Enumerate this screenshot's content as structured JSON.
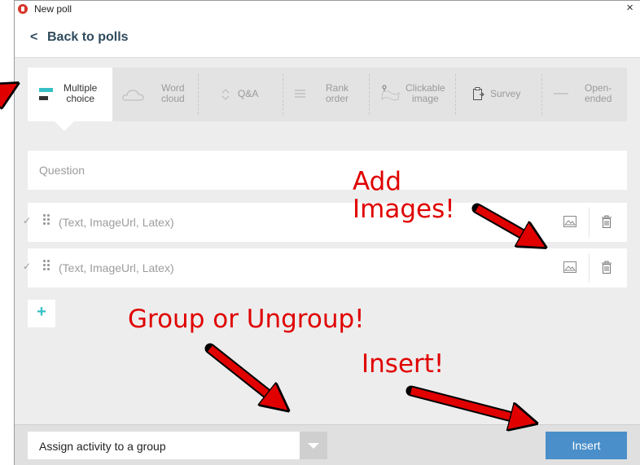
{
  "window": {
    "title": "New poll",
    "close_symbol": "×"
  },
  "nav": {
    "back_label": "Back to polls",
    "back_icon": "chevron-left-icon"
  },
  "poll_types": [
    {
      "label": "Multiple\nchoice",
      "icon": "multiple-choice-icon",
      "active": true
    },
    {
      "label": "Word\ncloud",
      "icon": "cloud-icon"
    },
    {
      "label": "Q&A",
      "icon": "up-down-icon"
    },
    {
      "label": "Rank\norder",
      "icon": "rank-list-icon"
    },
    {
      "label": "Clickable\nimage",
      "icon": "map-pin-icon"
    },
    {
      "label": "Survey",
      "icon": "clipboard-icon"
    },
    {
      "label": "Open-\nended",
      "icon": "dash-icon"
    }
  ],
  "question": {
    "placeholder": "Question"
  },
  "options": [
    {
      "placeholder": "(Text, ImageUrl, Latex)"
    },
    {
      "placeholder": "(Text, ImageUrl, Latex)"
    }
  ],
  "add_option": {
    "symbol": "+"
  },
  "footer": {
    "assign_label": "Assign activity to a group",
    "insert_label": "Insert"
  },
  "annotations": {
    "add_images": "Add\nImages!",
    "group": "Group or Ungroup!",
    "insert": "Insert!",
    "color": "#e00000"
  },
  "colors": {
    "accent_teal": "#35c0c6",
    "insert_blue": "#4a8fc9",
    "nav_text": "#2f4a5c"
  }
}
